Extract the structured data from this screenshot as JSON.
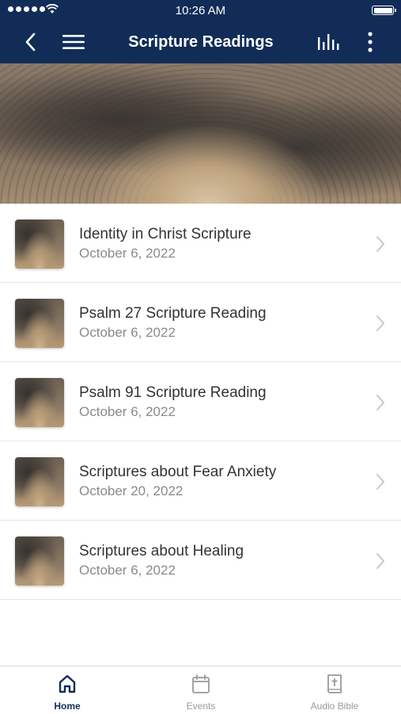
{
  "status_bar": {
    "time": "10:26 AM"
  },
  "nav": {
    "title": "Scripture Readings",
    "icons": [
      "back-chevron",
      "hamburger-menu",
      "bar-chart",
      "more-vertical"
    ]
  },
  "colors": {
    "brand": "#112d57",
    "title_text": "#333333",
    "date_text": "#8a8a8a"
  },
  "readings": [
    {
      "title": "Identity in Christ Scripture",
      "date": "October 6, 2022"
    },
    {
      "title": "Psalm 27 Scripture Reading",
      "date": "October 6, 2022"
    },
    {
      "title": "Psalm 91 Scripture Reading",
      "date": "October 6, 2022"
    },
    {
      "title": "Scriptures about Fear Anxiety",
      "date": "October 20, 2022"
    },
    {
      "title": "Scriptures about Healing",
      "date": "October 6, 2022"
    }
  ],
  "tabs": [
    {
      "label": "Home",
      "icon": "home-icon",
      "active": true
    },
    {
      "label": "Events",
      "icon": "calendar-icon",
      "active": false
    },
    {
      "label": "Audio Bible",
      "icon": "bible-icon",
      "active": false
    }
  ]
}
